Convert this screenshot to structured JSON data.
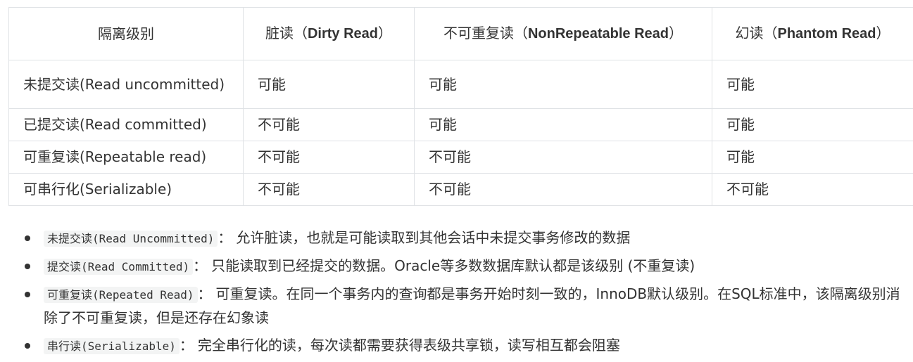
{
  "table": {
    "headers": [
      {
        "cjk": "隔离级别",
        "bold": ""
      },
      {
        "cjk": "脏读（",
        "bold": "Dirty Read",
        "tail": "）"
      },
      {
        "cjk": "不可重复读（",
        "bold": "NonRepeatable Read",
        "tail": "）"
      },
      {
        "cjk": "幻读（",
        "bold": "Phantom Read",
        "tail": "）"
      }
    ],
    "rows": [
      [
        "未提交读(Read uncommitted)",
        "可能",
        "可能",
        "可能"
      ],
      [
        "已提交读(Read committed)",
        "不可能",
        "可能",
        "可能"
      ],
      [
        "可重复读(Repeatable read)",
        "不可能",
        "不可能",
        "可能"
      ],
      [
        "可串行化(Serializable)",
        "不可能",
        "不可能",
        "不可能"
      ]
    ]
  },
  "list": [
    {
      "code": "未提交读(Read Uncommitted)",
      "text": "允许脏读，也就是可能读取到其他会话中未提交事务修改的数据"
    },
    {
      "code": "提交读(Read Committed)",
      "text": "只能读取到已经提交的数据。Oracle等多数数据库默认都是该级别 (不重复读)"
    },
    {
      "code": "可重复读(Repeated Read)",
      "text": "可重复读。在同一个事务内的查询都是事务开始时刻一致的，InnoDB默认级别。在SQL标准中，该隔离级别消除了不可重复读，但是还存在幻象读"
    },
    {
      "code": "串行读(Serializable)",
      "text": "完全串行化的读，每次读都需要获得表级共享锁，读写相互都会阻塞"
    }
  ],
  "colon": "："
}
